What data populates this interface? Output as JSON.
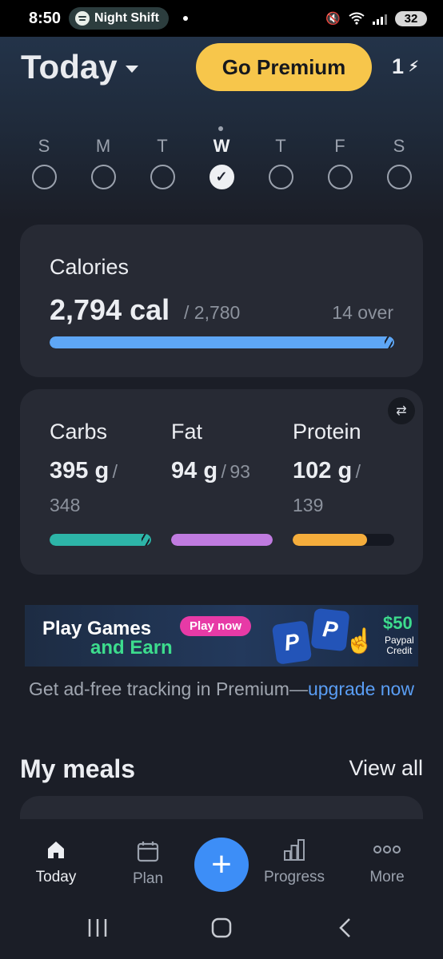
{
  "status_bar": {
    "time": "8:50",
    "night_shift_label": "Night Shift",
    "battery": "32"
  },
  "header": {
    "title": "Today",
    "premium_button": "Go Premium",
    "streak_count": "1"
  },
  "week": {
    "days": [
      {
        "letter": "S",
        "checked": false
      },
      {
        "letter": "M",
        "checked": false
      },
      {
        "letter": "T",
        "checked": false
      },
      {
        "letter": "W",
        "checked": true
      },
      {
        "letter": "T",
        "checked": false
      },
      {
        "letter": "F",
        "checked": false
      },
      {
        "letter": "S",
        "checked": false
      }
    ]
  },
  "calories": {
    "title": "Calories",
    "value": "2,794 cal",
    "target": "/ 2,780",
    "status": "14 over",
    "progress": 1.0,
    "color": "#5ea6f5"
  },
  "macros": [
    {
      "name": "Carbs",
      "value": "395 g",
      "slash": "/",
      "target": "348",
      "progress": 1.0,
      "color": "#2db5a8"
    },
    {
      "name": "Fat",
      "value": "94 g",
      "slash": "/",
      "target": "93",
      "progress": 1.0,
      "color": "#c07be0"
    },
    {
      "name": "Protein",
      "value": "102 g",
      "slash": "/",
      "target": "139",
      "progress": 0.73,
      "color": "#f5ad3c"
    }
  ],
  "ad": {
    "line1": "Play Games",
    "line2": "and Earn",
    "cta": "Play now",
    "amount": "$50",
    "sub1": "Paypal",
    "sub2": "Credit"
  },
  "upgrade": {
    "text": "Get ad-free tracking in Premium—",
    "link": "upgrade now"
  },
  "meals": {
    "title": "My meals",
    "view_all": "View all"
  },
  "bottom_nav": {
    "today": "Today",
    "plan": "Plan",
    "add": "+",
    "progress": "Progress",
    "more": "More"
  },
  "colors": {
    "premium": "#f7c64b",
    "fab": "#3d8ef7",
    "link": "#5a9ef5"
  }
}
